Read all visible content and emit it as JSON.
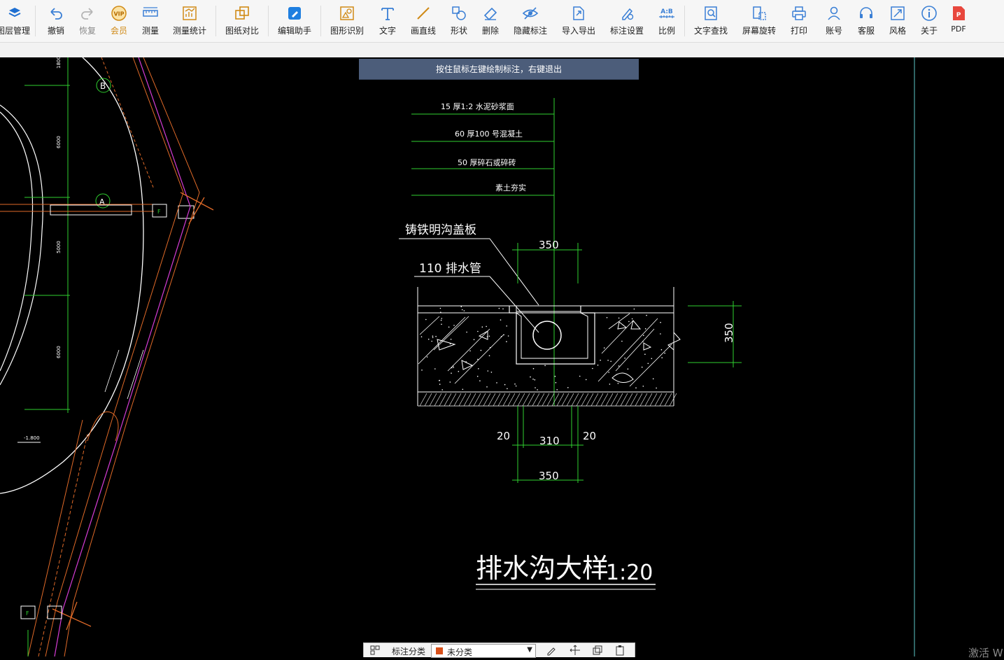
{
  "toolbar": {
    "items": [
      {
        "label": "图层管理",
        "icon": "layers-icon"
      },
      {
        "label": "撤销",
        "icon": "undo-icon"
      },
      {
        "label": "恢复",
        "icon": "redo-icon"
      },
      {
        "label": "会员",
        "icon": "vip-icon"
      },
      {
        "label": "测量",
        "icon": "ruler-icon"
      },
      {
        "label": "测量统计",
        "icon": "measure-stats-icon"
      },
      {
        "label": "图纸对比",
        "icon": "compare-icon"
      },
      {
        "label": "编辑助手",
        "icon": "edit-assistant-icon"
      },
      {
        "label": "图形识别",
        "icon": "shape-recognize-icon"
      },
      {
        "label": "文字",
        "icon": "text-icon"
      },
      {
        "label": "画直线",
        "icon": "line-icon"
      },
      {
        "label": "形状",
        "icon": "shapes-icon"
      },
      {
        "label": "删除",
        "icon": "eraser-icon"
      },
      {
        "label": "隐藏标注",
        "icon": "hide-eye-icon"
      },
      {
        "label": "导入导出",
        "icon": "import-export-icon"
      },
      {
        "label": "标注设置",
        "icon": "annotation-settings-icon"
      },
      {
        "label": "比例",
        "icon": "scale-icon"
      },
      {
        "label": "文字查找",
        "icon": "text-search-icon"
      },
      {
        "label": "屏幕旋转",
        "icon": "rotate-screen-icon"
      },
      {
        "label": "打印",
        "icon": "print-icon"
      },
      {
        "label": "账号",
        "icon": "user-icon"
      },
      {
        "label": "客服",
        "icon": "headset-icon"
      },
      {
        "label": "风格",
        "icon": "style-icon"
      },
      {
        "label": "关于",
        "icon": "info-icon"
      },
      {
        "label": "PDF",
        "icon": "pdf-icon"
      }
    ],
    "vip_text": "VIP",
    "scale_glyph": "A:B",
    "pdf_glyph": "P"
  },
  "hint": "按住鼠标左键绘制标注，右键退出",
  "drawing": {
    "layers": [
      "15 厚1:2 水泥砂浆面",
      "60 厚100 号混凝土",
      "50 厚碎石或碎砖",
      "素土夯实"
    ],
    "cover_label": "铸铁明沟盖板",
    "pipe_label": "110 排水管",
    "dim_top": "350",
    "dim_right": "350",
    "dim_left_20": "20",
    "dim_mid_310": "310",
    "dim_right_20": "20",
    "dim_bottom": "350",
    "title": "排水沟大样",
    "scale": "1:20",
    "plan_labels": {
      "mark_b": "B",
      "mark_a": "A",
      "mark_f1": "F",
      "mark_f2": "F",
      "dim_1800": "1800",
      "dim_6000a": "6000",
      "dim_5000": "5000",
      "dim_6000b": "6000",
      "level": "-1.800"
    }
  },
  "bottom_bar": {
    "label": "标注分类",
    "select_value": "未分类",
    "select_color": "#d8501a"
  },
  "watermark": "激活 W"
}
